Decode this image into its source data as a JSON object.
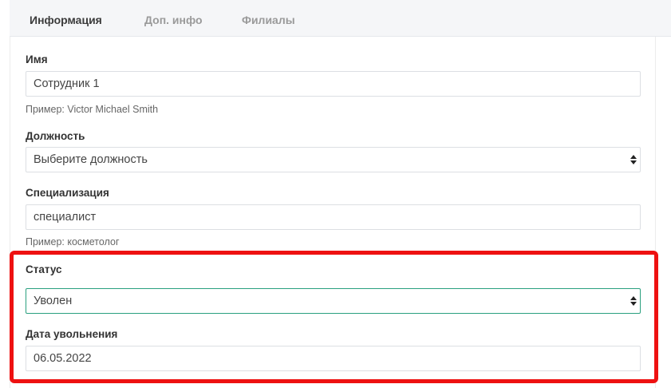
{
  "tabs": [
    {
      "label": "Информация",
      "active": true
    },
    {
      "label": "Доп. инфо",
      "active": false
    },
    {
      "label": "Филиалы",
      "active": false
    }
  ],
  "form": {
    "name": {
      "label": "Имя",
      "value": "Сотрудник 1",
      "hint": "Пример: Victor Michael Smith"
    },
    "position": {
      "label": "Должность",
      "value": "Выберите должность"
    },
    "specialization": {
      "label": "Специализация",
      "value": "специалист",
      "hint": "Пример: косметолог"
    },
    "status": {
      "label": "Статус",
      "value": "Уволен"
    },
    "dismissal_date": {
      "label": "Дата увольнения",
      "value": "06.05.2022"
    }
  },
  "colors": {
    "accent_focus": "#2aa07f",
    "highlight": "#ee1111"
  },
  "icons": {
    "select_arrows": "select-arrows-icon"
  }
}
